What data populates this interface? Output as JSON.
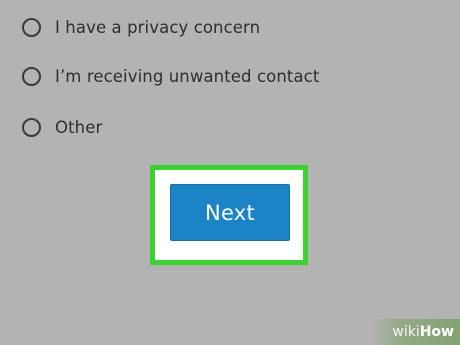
{
  "options": [
    {
      "label": "I have a privacy concern"
    },
    {
      "label": "I’m receiving unwanted contact"
    },
    {
      "label": "Other"
    }
  ],
  "next_button": {
    "label": "Next"
  },
  "watermark": {
    "prefix": "wiki",
    "suffix": "How"
  },
  "colors": {
    "background": "#b3b3b3",
    "button": "#1a84c6",
    "highlight_border": "#39d42e"
  }
}
